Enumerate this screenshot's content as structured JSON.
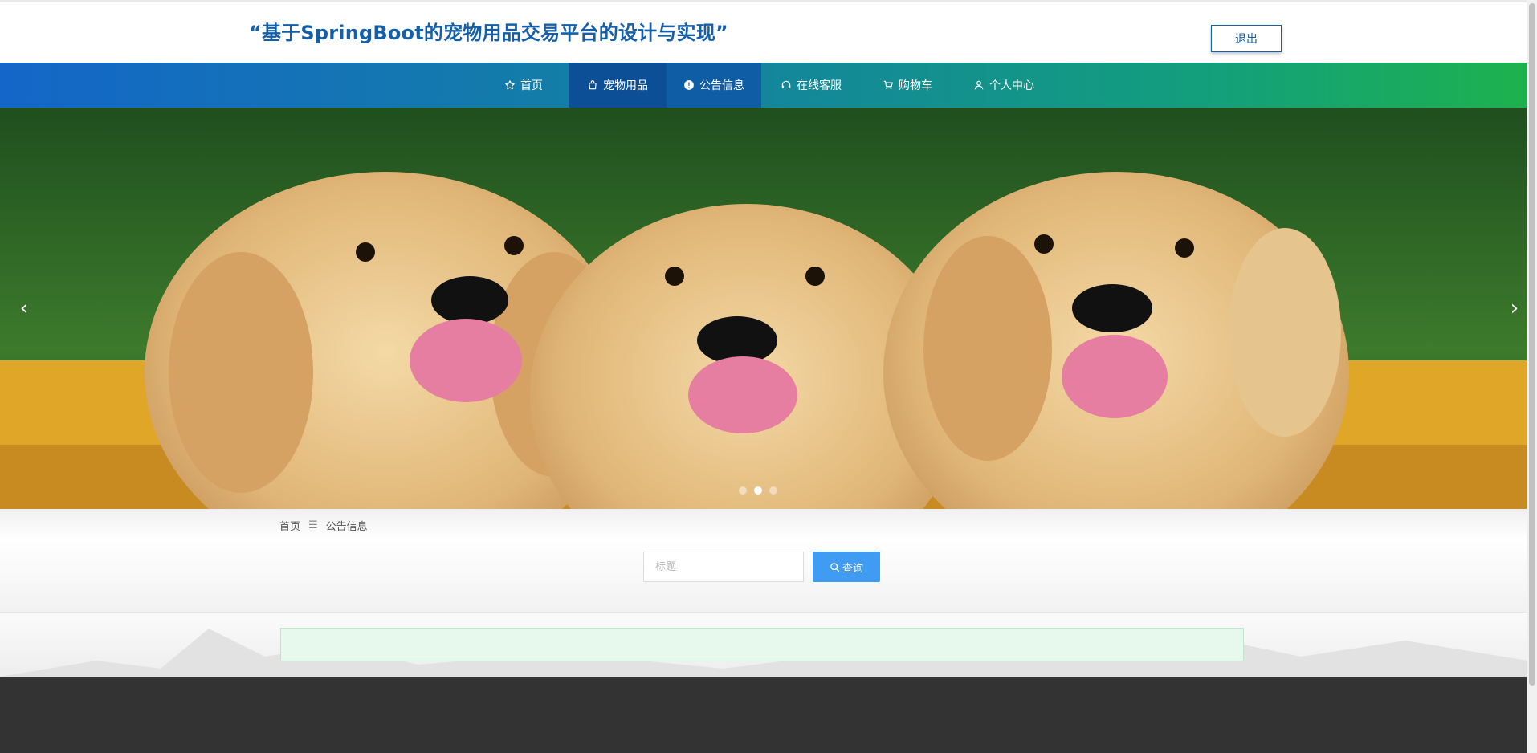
{
  "header": {
    "title": "“基于SpringBoot的宠物用品交易平台的设计与实现”",
    "logout_label": "退出"
  },
  "nav": {
    "items": [
      {
        "label": "首页",
        "icon": "star-icon"
      },
      {
        "label": "宠物用品",
        "icon": "bag-icon"
      },
      {
        "label": "公告信息",
        "icon": "info-icon"
      },
      {
        "label": "在线客服",
        "icon": "headset-icon"
      },
      {
        "label": "购物车",
        "icon": "cart-icon"
      },
      {
        "label": "个人中心",
        "icon": "user-icon"
      }
    ],
    "active": "宠物用品"
  },
  "carousel": {
    "prev_label": "‹",
    "next_label": "›",
    "active_index": 1
  },
  "breadcrumb": {
    "home": "首页",
    "separator": "☰",
    "current": "公告信息"
  },
  "search": {
    "placeholder": "标题",
    "button_label": "查询"
  },
  "colors": {
    "accent": "#155fa8",
    "search_button": "#3f9cf2",
    "notice_bg": "#e7f8ec"
  }
}
